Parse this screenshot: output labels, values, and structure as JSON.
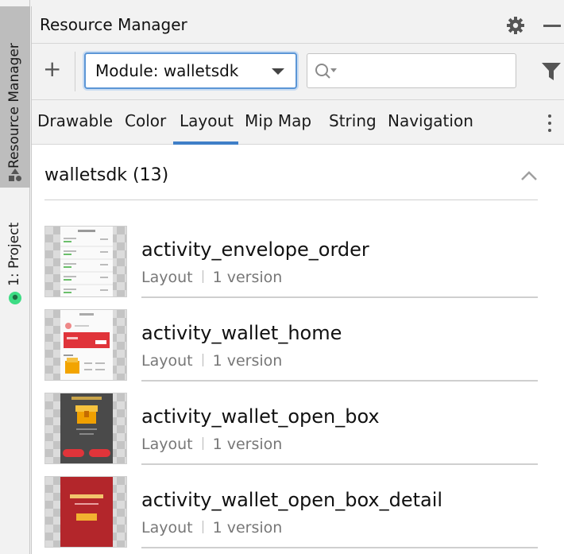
{
  "side_strip": {
    "resource_manager_tab": "Resource Manager",
    "project_tab": "1: Project"
  },
  "panel": {
    "title": "Resource Manager"
  },
  "toolbar": {
    "add_label": "+",
    "module_select_value": "Module: walletsdk",
    "search_placeholder": ""
  },
  "tabs": [
    {
      "label": "Drawable"
    },
    {
      "label": "Color"
    },
    {
      "label": "Layout"
    },
    {
      "label": "Mip Map"
    },
    {
      "label": "String"
    },
    {
      "label": "Navigation"
    }
  ],
  "selected_tab": "Layout",
  "group": {
    "title": "walletsdk (13)"
  },
  "resources": [
    {
      "name": "activity_envelope_order",
      "type": "Layout",
      "versions": "1 version"
    },
    {
      "name": "activity_wallet_home",
      "type": "Layout",
      "versions": "1 version"
    },
    {
      "name": "activity_wallet_open_box",
      "type": "Layout",
      "versions": "1 version"
    },
    {
      "name": "activity_wallet_open_box_detail",
      "type": "Layout",
      "versions": "1 version"
    }
  ],
  "colors": {
    "accent": "#3f7fc7",
    "select_border": "#5c96d6",
    "android_green": "#3ddc84"
  },
  "icons": [
    "resource-manager-icon",
    "android-icon",
    "gear-icon",
    "minimize-icon",
    "search-icon",
    "filter-icon",
    "more-vert-icon",
    "chevron-up-icon"
  ]
}
